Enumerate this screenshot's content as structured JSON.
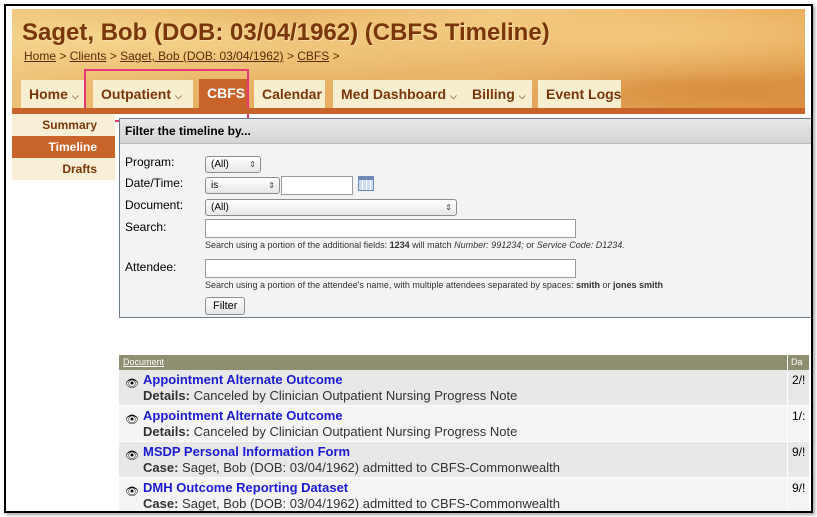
{
  "header": {
    "title": "Saget, Bob (DOB: 03/04/1962) (CBFS Timeline)",
    "breadcrumb": [
      {
        "label": "Home"
      },
      {
        "label": "Clients"
      },
      {
        "label": "Saget, Bob (DOB: 03/04/1962)"
      },
      {
        "label": "CBFS"
      }
    ],
    "separator": ">"
  },
  "tabs": [
    {
      "label": "Home",
      "has_menu": true,
      "active": false
    },
    {
      "label": "Outpatient",
      "has_menu": true,
      "active": false
    },
    {
      "label": "CBFS",
      "has_menu": false,
      "active": true
    },
    {
      "label": "Calendar",
      "has_menu": false,
      "active": false
    },
    {
      "label": "Med Dashboard",
      "has_menu": true,
      "active": false
    },
    {
      "label": "Billing",
      "has_menu": true,
      "active": false
    },
    {
      "label": "Event Logs",
      "has_menu": false,
      "active": false
    }
  ],
  "sidenav": [
    {
      "label": "Summary",
      "active": false
    },
    {
      "label": "Timeline",
      "active": true
    },
    {
      "label": "Drafts",
      "active": false
    }
  ],
  "filter": {
    "heading": "Filter the timeline by...",
    "program_label": "Program:",
    "program_value": "(All)",
    "datetime_label": "Date/Time:",
    "datetime_op": "is",
    "datetime_value": "",
    "document_label": "Document:",
    "document_value": "(All)",
    "search_label": "Search:",
    "search_value": "",
    "search_hint_pre": "Search using a portion of the additional fields: ",
    "search_hint_code": "1234",
    "search_hint_mid": " will match ",
    "search_hint_ex1": "Number: 991234;",
    "search_hint_or": " or ",
    "search_hint_ex2": "Service Code: D1234.",
    "attendee_label": "Attendee:",
    "attendee_value": "",
    "attendee_hint_pre": "Search using a portion of the attendee's name, with multiple attendees separated by spaces: ",
    "attendee_hint_ex1": "smith",
    "attendee_hint_or": " or ",
    "attendee_hint_ex2": "jones smith",
    "button_label": "Filter"
  },
  "results": {
    "columns": [
      "Document",
      "Da"
    ],
    "rows": [
      {
        "title": "Appointment Alternate Outcome",
        "detail_label": "Details:",
        "detail": "Canceled by Clinician Outpatient Nursing Progress Note",
        "date": "2/!"
      },
      {
        "title": "Appointment Alternate Outcome",
        "detail_label": "Details:",
        "detail": "Canceled by Clinician Outpatient Nursing Progress Note",
        "date": "1/:"
      },
      {
        "title": "MSDP Personal Information Form",
        "detail_label": "Case:",
        "detail": "Saget, Bob (DOB: 03/04/1962) admitted to CBFS-Commonwealth",
        "date": "9/!"
      },
      {
        "title": "DMH Outcome Reporting Dataset",
        "detail_label": "Case:",
        "detail": "Saget, Bob (DOB: 03/04/1962) admitted to CBFS-Commonwealth",
        "date": "9/!"
      }
    ]
  },
  "colors": {
    "brand_orange": "#c8642a",
    "tab_bg": "#f7eed0",
    "title_brown": "#7a3508",
    "link_blue": "#1b1bd3",
    "highlight_pink": "#e5397a"
  },
  "icons": {
    "caret": "chevron-down-icon",
    "view": "eye-icon",
    "calendar": "calendar-icon"
  }
}
